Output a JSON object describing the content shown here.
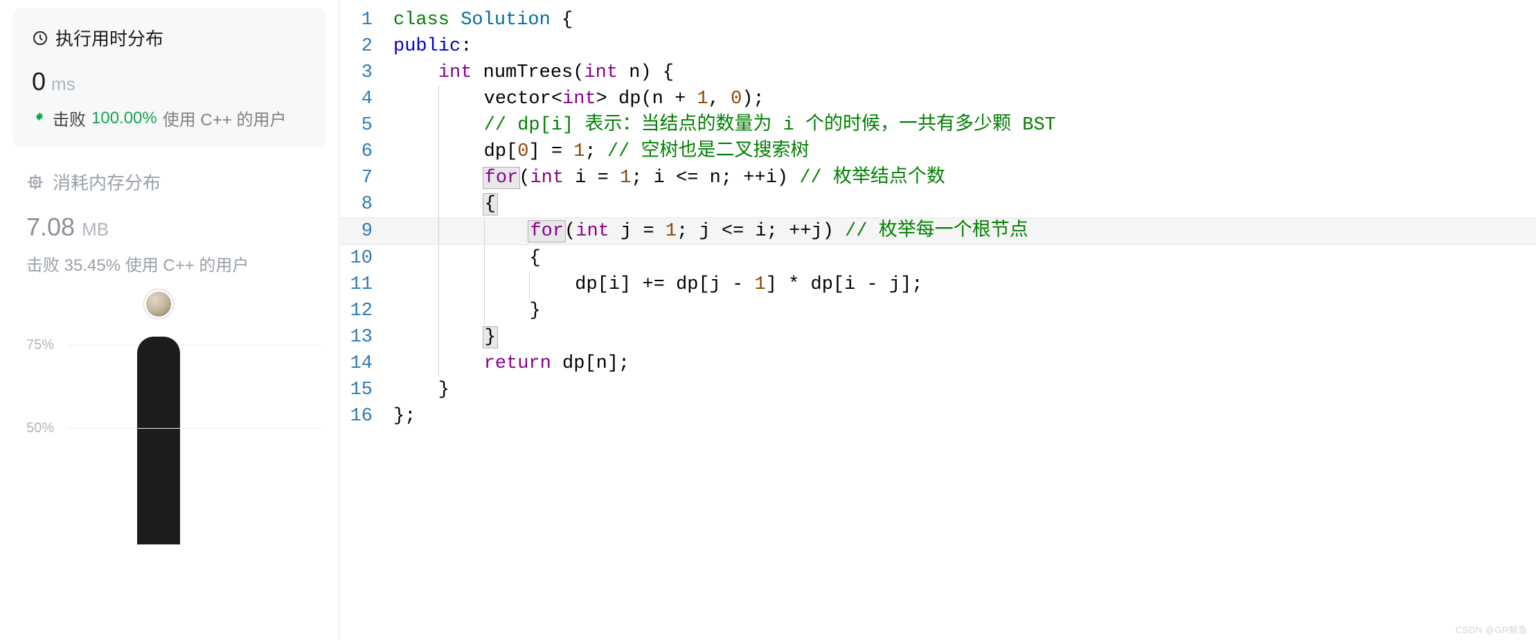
{
  "runtime": {
    "title": "执行用时分布",
    "value": "0",
    "unit": "ms",
    "beat_label": "击败",
    "beat_percent": "100.00%",
    "beat_suffix": "使用 C++ 的用户"
  },
  "memory": {
    "title": "消耗内存分布",
    "value": "7.08",
    "unit": "MB",
    "beat_text": "击败 35.45% 使用 C++ 的用户"
  },
  "chart_data": {
    "type": "bar",
    "ticks": [
      "75%",
      "50%"
    ],
    "highlighted_bin_percent": 100,
    "note": "runtime distribution histogram; single dark bar with avatar marker above ~50% baseline"
  },
  "code": {
    "lines": [
      {
        "n": 1,
        "tokens": [
          [
            "k-class",
            "class"
          ],
          [
            "",
            " "
          ],
          [
            "k-type",
            "Solution"
          ],
          [
            "",
            " {"
          ]
        ]
      },
      {
        "n": 2,
        "tokens": [
          [
            "k-access",
            "public"
          ],
          [
            "k-op",
            ":"
          ]
        ]
      },
      {
        "n": 3,
        "tokens": [
          [
            "",
            "    "
          ],
          [
            "k-keyword",
            "int"
          ],
          [
            "",
            " "
          ],
          [
            "k-func",
            "numTrees"
          ],
          [
            "",
            "("
          ],
          [
            "k-keyword",
            "int"
          ],
          [
            "",
            " n) {"
          ]
        ]
      },
      {
        "n": 4,
        "indent": 2,
        "tokens": [
          [
            "",
            "vector<"
          ],
          [
            "k-keyword",
            "int"
          ],
          [
            "",
            "> dp(n + "
          ],
          [
            "k-num",
            "1"
          ],
          [
            "",
            ", "
          ],
          [
            "k-num",
            "0"
          ],
          [
            "",
            ");"
          ]
        ]
      },
      {
        "n": 5,
        "indent": 2,
        "tokens": [
          [
            "k-comment",
            "// dp[i] 表示：当结点的数量为 i 个的时候，一共有多少颗 BST"
          ]
        ]
      },
      {
        "n": 6,
        "indent": 2,
        "tokens": [
          [
            "",
            "dp["
          ],
          [
            "k-num",
            "0"
          ],
          [
            "",
            "] = "
          ],
          [
            "k-num",
            "1"
          ],
          [
            "",
            "; "
          ],
          [
            "k-comment",
            "// 空树也是二叉搜索树"
          ]
        ]
      },
      {
        "n": 7,
        "indent": 2,
        "tokens": [
          [
            "k-keyword hl",
            "for"
          ],
          [
            "",
            "("
          ],
          [
            "k-keyword",
            "int"
          ],
          [
            "",
            " i = "
          ],
          [
            "k-num",
            "1"
          ],
          [
            "",
            "; i <= n; ++i) "
          ],
          [
            "k-comment",
            "// 枚举结点个数"
          ]
        ]
      },
      {
        "n": 8,
        "indent": 2,
        "tokens": [
          [
            "hl",
            "{"
          ]
        ]
      },
      {
        "n": 9,
        "indent": 3,
        "highlight": true,
        "tokens": [
          [
            "k-keyword hl",
            "for"
          ],
          [
            "",
            "("
          ],
          [
            "k-keyword",
            "int"
          ],
          [
            "",
            " j = "
          ],
          [
            "k-num",
            "1"
          ],
          [
            "",
            "; j <= i; ++j) "
          ],
          [
            "k-comment",
            "// 枚举每一个根节点"
          ]
        ]
      },
      {
        "n": 10,
        "indent": 3,
        "tokens": [
          [
            "",
            "{"
          ]
        ]
      },
      {
        "n": 11,
        "indent": 4,
        "tokens": [
          [
            "",
            "dp[i] += dp[j - "
          ],
          [
            "k-num",
            "1"
          ],
          [
            "",
            "] * dp[i - j];"
          ]
        ]
      },
      {
        "n": 12,
        "indent": 3,
        "tokens": [
          [
            "",
            "}"
          ]
        ]
      },
      {
        "n": 13,
        "indent": 2,
        "tokens": [
          [
            "hl",
            "}"
          ]
        ]
      },
      {
        "n": 14,
        "indent": 2,
        "tokens": [
          [
            "k-keyword",
            "return"
          ],
          [
            "",
            " dp[n];"
          ]
        ]
      },
      {
        "n": 15,
        "tokens": [
          [
            "",
            "    }"
          ]
        ]
      },
      {
        "n": 16,
        "tokens": [
          [
            "",
            "};"
          ]
        ]
      }
    ]
  },
  "watermark": "CSDN @GR鲸鱼"
}
